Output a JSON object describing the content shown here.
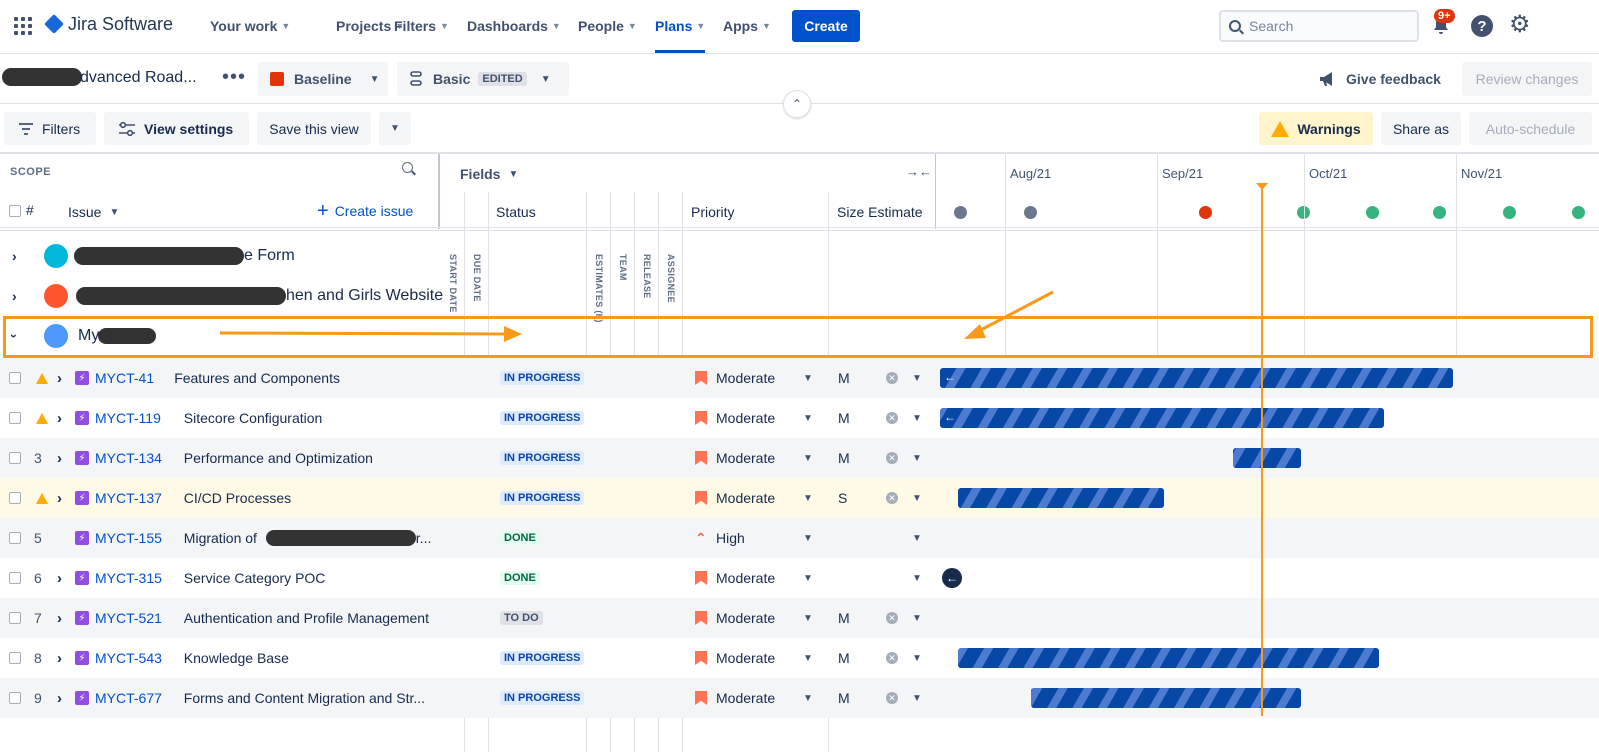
{
  "nav": {
    "logo": "Jira Software",
    "items": [
      "Your work",
      "Projects",
      "Filters",
      "Dashboards",
      "People",
      "Plans",
      "Apps"
    ],
    "create": "Create",
    "search_placeholder": "Search",
    "notif_count": "9+"
  },
  "planbar": {
    "title": "dvanced Road...",
    "baseline": "Baseline",
    "basic": "Basic",
    "edited": "EDITED",
    "feedback": "Give feedback",
    "review": "Review changes"
  },
  "toolbar": {
    "filters": "Filters",
    "view_settings": "View settings",
    "save_view": "Save this view",
    "warnings": "Warnings",
    "share": "Share as",
    "auto_schedule": "Auto-schedule"
  },
  "scope": {
    "label": "SCOPE",
    "hash": "#",
    "issue": "Issue",
    "create_issue": "Create issue"
  },
  "fields": {
    "label": "Fields",
    "status": "Status",
    "priority": "Priority",
    "size": "Size Estimate",
    "start_date": "START DATE",
    "due_date": "DUE DATE",
    "estimates": "ESTIMATES (h)",
    "team": "TEAM",
    "release": "RELEASE",
    "assignee": "ASSIGNEE"
  },
  "timeline": {
    "months": [
      "Aug/21",
      "Sep/21",
      "Oct/21",
      "Nov/21"
    ]
  },
  "projects": [
    {
      "name": "e Form"
    },
    {
      "name": "hen and Girls Website"
    },
    {
      "name": "My"
    }
  ],
  "rows": [
    {
      "num": "",
      "key": "MYCT-41",
      "summary": "Features and Components",
      "status": "IN PROGRESS",
      "priority": "Moderate",
      "size": "M"
    },
    {
      "num": "",
      "key": "MYCT-119",
      "summary": "Sitecore Configuration",
      "status": "IN PROGRESS",
      "priority": "Moderate",
      "size": "M"
    },
    {
      "num": "3",
      "key": "MYCT-134",
      "summary": "Performance and Optimization",
      "status": "IN PROGRESS",
      "priority": "Moderate",
      "size": "M"
    },
    {
      "num": "",
      "key": "MYCT-137",
      "summary": "CI/CD Processes",
      "status": "IN PROGRESS",
      "priority": "Moderate",
      "size": "S"
    },
    {
      "num": "5",
      "key": "MYCT-155",
      "summary": "Migration of",
      "summary_tail": "r...",
      "status": "DONE",
      "priority": "High",
      "size": ""
    },
    {
      "num": "6",
      "key": "MYCT-315",
      "summary": "Service Category POC",
      "status": "DONE",
      "priority": "Moderate",
      "size": ""
    },
    {
      "num": "7",
      "key": "MYCT-521",
      "summary": "Authentication and Profile Management",
      "status": "TO DO",
      "priority": "Moderate",
      "size": "M"
    },
    {
      "num": "8",
      "key": "MYCT-543",
      "summary": "Knowledge Base",
      "status": "IN PROGRESS",
      "priority": "Moderate",
      "size": "M"
    },
    {
      "num": "9",
      "key": "MYCT-677",
      "summary": "Forms and Content Migration and Str...",
      "status": "IN PROGRESS",
      "priority": "Moderate",
      "size": "M"
    }
  ],
  "colors": {
    "accent": "#0052cc",
    "highlight": "#f79a1b",
    "warning": "#ffab00",
    "bar": "#0747a6"
  }
}
